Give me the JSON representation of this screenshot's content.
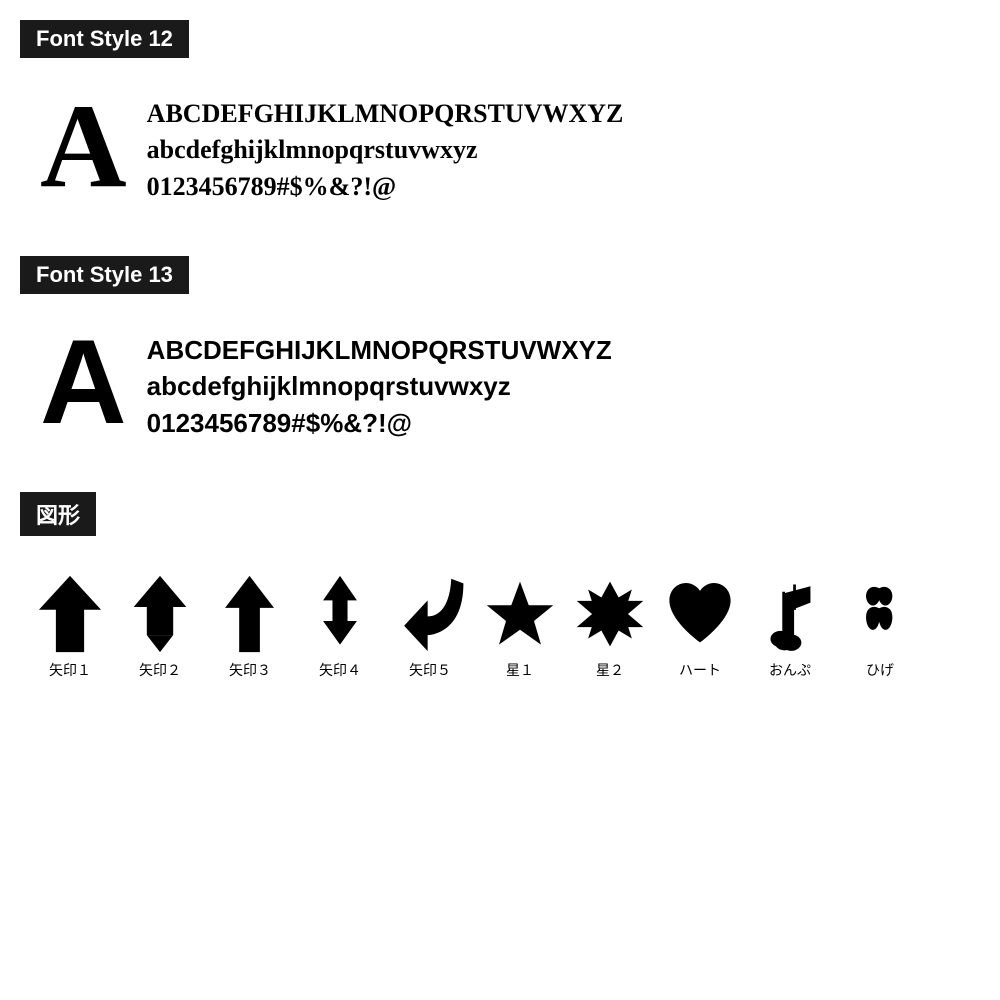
{
  "sections": [
    {
      "id": "font-style-12",
      "header": "Font Style 12",
      "big_letter": "A",
      "rows": [
        "ABCDEFGHIJKLMNOPQRSTUVWXYZ",
        "abcdefghijklmnopqrstuvwxyz",
        "0123456789#$%&?!@"
      ],
      "style": "serif"
    },
    {
      "id": "font-style-13",
      "header": "Font Style 13",
      "big_letter": "A",
      "rows": [
        "ABCDEFGHIJKLMNOPQRSTUVWXYZ",
        "abcdefghijklmnopqrstuvwxyz",
        "0123456789#$%&?!@"
      ],
      "style": "sans-serif"
    }
  ],
  "shapes_header": "図形",
  "shapes": [
    {
      "id": "yajirushi1",
      "label": "矢印１",
      "type": "arrow1"
    },
    {
      "id": "yajirushi2",
      "label": "矢印２",
      "type": "arrow2"
    },
    {
      "id": "yajirushi3",
      "label": "矢印３",
      "type": "arrow3"
    },
    {
      "id": "yajirushi4",
      "label": "矢印４",
      "type": "arrow4"
    },
    {
      "id": "yajirushi5",
      "label": "矢印５",
      "type": "arrow5"
    },
    {
      "id": "hoshi1",
      "label": "星１",
      "type": "star5"
    },
    {
      "id": "hoshi2",
      "label": "星２",
      "type": "star6"
    },
    {
      "id": "heart",
      "label": "ハート",
      "type": "heart"
    },
    {
      "id": "onpu",
      "label": "おんぷ",
      "type": "music"
    },
    {
      "id": "hige",
      "label": "ひげ",
      "type": "hige"
    }
  ]
}
